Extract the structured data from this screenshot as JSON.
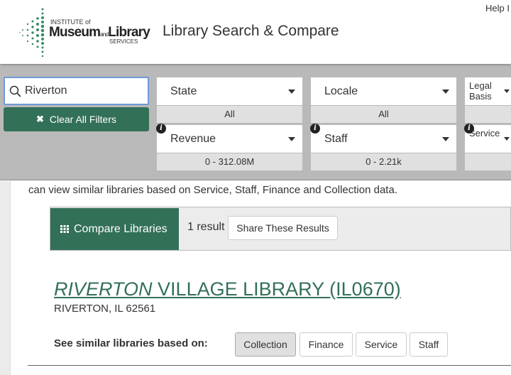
{
  "header": {
    "help_label": "Help I",
    "title": "Library Search & Compare",
    "logo": {
      "line1": "INSTITUTE of",
      "line2a": "Museum",
      "line2b": "and",
      "line2c": "Library",
      "line3": "SERVICES"
    }
  },
  "search": {
    "value": "Riverton",
    "placeholder": ""
  },
  "clear_filters_label": "Clear All Filters",
  "filters": [
    {
      "label": "State",
      "value": "All",
      "info": false
    },
    {
      "label": "Locale",
      "value": "All",
      "info": false
    },
    {
      "label": "Legal Basis",
      "value": "",
      "info": false
    },
    {
      "label": "Revenue",
      "value": "0 - 312.08M",
      "info": true
    },
    {
      "label": "Staff",
      "value": "0 - 2.21k",
      "info": true
    },
    {
      "label": "Service",
      "value": "",
      "info": true
    }
  ],
  "intro_text": "can view similar libraries based on Service, Staff, Finance and Collection data.",
  "results": {
    "compare_label": "Compare Libraries",
    "count_label": "1 result",
    "share_label": "Share These Results"
  },
  "library": {
    "name_highlight": "RIVERTON",
    "name_rest": " VILLAGE LIBRARY (IL0670)",
    "address": "RIVERTON, IL 62561"
  },
  "similar": {
    "label": "See similar libraries based on:",
    "options": [
      "Collection",
      "Finance",
      "Service",
      "Staff"
    ],
    "active": "Collection"
  },
  "colors": {
    "brand_green": "#337058",
    "filter_band": "#b9b9b9"
  }
}
